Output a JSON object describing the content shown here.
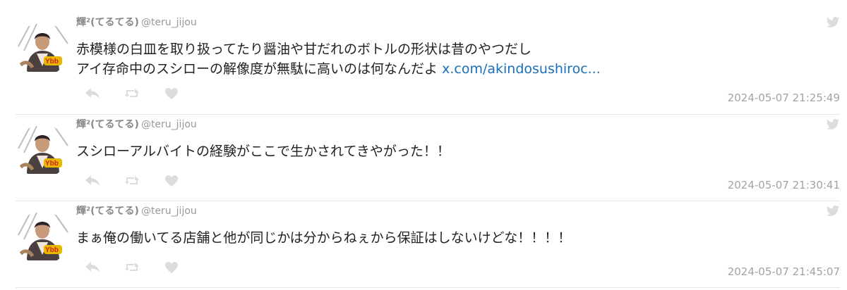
{
  "colors": {
    "divider": "#e6e6e6",
    "link": "#1a6fb8",
    "meta": "#a3a3a3",
    "icon": "#dcdcdc"
  },
  "tweets": [
    {
      "display_name": "輝²(てるてる)",
      "handle": "@teru_jijou",
      "lines": [
        "赤模様の白皿を取り扱ってたり醤油や甘だれのボトルの形状は昔のやつだし",
        "アイ存命中のスシローの解像度が無駄に高いのは何なんだよ "
      ],
      "link_text": "x.com/akindosushiroc...",
      "timestamp": "2024-05-07 21:25:49",
      "icons": [
        "reply-icon",
        "retweet-icon",
        "like-icon",
        "twitter-bird-icon"
      ]
    },
    {
      "display_name": "輝²(てるてる)",
      "handle": "@teru_jijou",
      "lines": [
        "スシローアルバイトの経験がここで生かされてきやがった！！"
      ],
      "timestamp": "2024-05-07 21:30:41",
      "icons": [
        "reply-icon",
        "retweet-icon",
        "like-icon",
        "twitter-bird-icon"
      ]
    },
    {
      "display_name": "輝²(てるてる)",
      "handle": "@teru_jijou",
      "lines": [
        "まぁ俺の働いてる店舗と他が同じかは分からねぇから保証はしないけどな！！！！"
      ],
      "timestamp": "2024-05-07 21:45:07",
      "icons": [
        "reply-icon",
        "retweet-icon",
        "like-icon",
        "twitter-bird-icon"
      ]
    }
  ]
}
